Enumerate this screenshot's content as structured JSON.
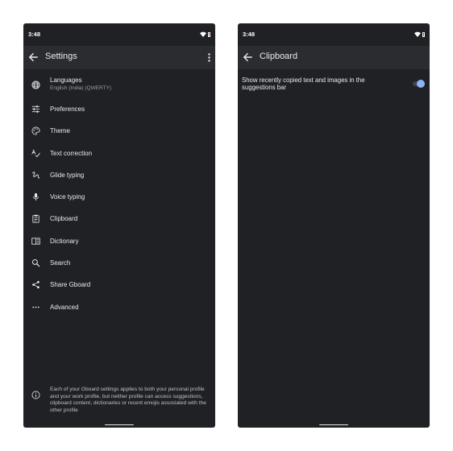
{
  "left_screen": {
    "status_time": "3:48",
    "title": "Settings",
    "items": [
      {
        "label": "Languages",
        "sublabel": "English (India) (QWERTY)",
        "icon": "globe-icon"
      },
      {
        "label": "Preferences",
        "icon": "sliders-icon"
      },
      {
        "label": "Theme",
        "icon": "palette-icon"
      },
      {
        "label": "Text correction",
        "icon": "spellcheck-icon"
      },
      {
        "label": "Glide typing",
        "icon": "gesture-icon"
      },
      {
        "label": "Voice typing",
        "icon": "mic-icon"
      },
      {
        "label": "Clipboard",
        "icon": "clipboard-icon"
      },
      {
        "label": "Dictionary",
        "icon": "book-icon"
      },
      {
        "label": "Search",
        "icon": "search-icon"
      },
      {
        "label": "Share Gboard",
        "icon": "share-icon"
      },
      {
        "label": "Advanced",
        "icon": "more-horiz-icon"
      }
    ],
    "footer_text": "Each of your Gboard settings applies to both your personal profile and your work profile, but neither profile can access suggestions, clipboard content, dictionaries or recent emojis associated with the other profile"
  },
  "right_screen": {
    "status_time": "3:48",
    "title": "Clipboard",
    "setting_text": "Show recently copied text and images in the suggestions bar",
    "toggle_on": true
  },
  "colors": {
    "background": "#202124",
    "appbar": "#2b2c30",
    "text": "#e8eaed",
    "secondary_text": "#9aa0a6",
    "accent": "#8ab4f8",
    "battery_low": "#ea4335"
  }
}
